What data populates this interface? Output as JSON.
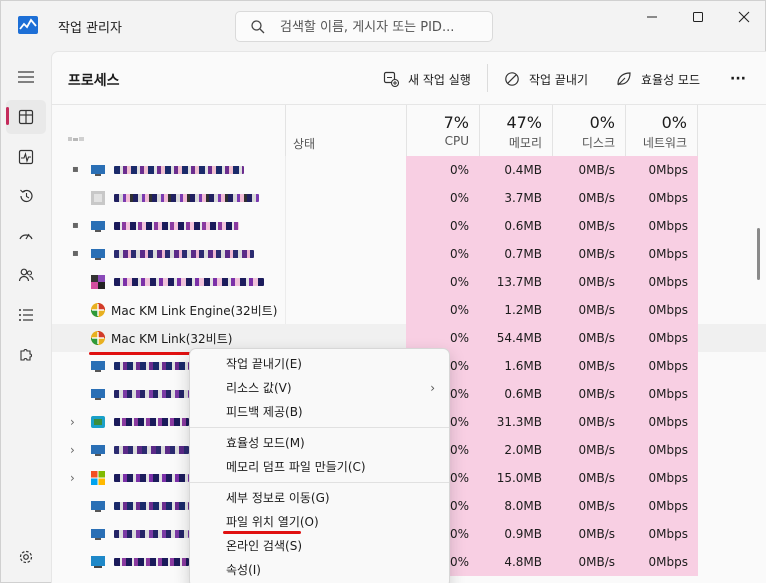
{
  "app": {
    "title": "작업 관리자"
  },
  "search": {
    "placeholder": "검색할 이름, 게시자 또는 PID..."
  },
  "page": {
    "title": "프로세스"
  },
  "toolbar": {
    "run_new_task": "새 작업 실행",
    "end_task": "작업 끝내기",
    "efficiency_mode": "효율성 모드",
    "more": "···"
  },
  "columns": {
    "name": "",
    "status": "상태",
    "cpu": {
      "pct": "7%",
      "label": "CPU"
    },
    "memory": {
      "pct": "47%",
      "label": "메모리"
    },
    "disk": {
      "pct": "0%",
      "label": "디스크"
    },
    "network": {
      "pct": "0%",
      "label": "네트워크"
    }
  },
  "rows": [
    {
      "name": "",
      "cpu": "0%",
      "mem": "0.4MB",
      "disk": "0MB/s",
      "net": "0Mbps"
    },
    {
      "name": "",
      "cpu": "0%",
      "mem": "3.7MB",
      "disk": "0MB/s",
      "net": "0Mbps"
    },
    {
      "name": "",
      "cpu": "0%",
      "mem": "0.6MB",
      "disk": "0MB/s",
      "net": "0Mbps"
    },
    {
      "name": "",
      "cpu": "0%",
      "mem": "0.7MB",
      "disk": "0MB/s",
      "net": "0Mbps"
    },
    {
      "name": "",
      "cpu": "0%",
      "mem": "13.7MB",
      "disk": "0MB/s",
      "net": "0Mbps"
    },
    {
      "name": "Mac KM Link Engine(32비트)",
      "cpu": "0%",
      "mem": "1.2MB",
      "disk": "0MB/s",
      "net": "0Mbps"
    },
    {
      "name": "Mac KM Link(32비트)",
      "cpu": "0%",
      "mem": "54.4MB",
      "disk": "0MB/s",
      "net": "0Mbps"
    },
    {
      "name": "",
      "cpu": "0%",
      "mem": "1.6MB",
      "disk": "0MB/s",
      "net": "0Mbps"
    },
    {
      "name": "",
      "cpu": "0%",
      "mem": "0.6MB",
      "disk": "0MB/s",
      "net": "0Mbps"
    },
    {
      "name": "",
      "cpu": "0%",
      "mem": "31.3MB",
      "disk": "0MB/s",
      "net": "0Mbps"
    },
    {
      "name": "",
      "cpu": "0%",
      "mem": "2.0MB",
      "disk": "0MB/s",
      "net": "0Mbps"
    },
    {
      "name": "",
      "cpu": "0%",
      "mem": "15.0MB",
      "disk": "0MB/s",
      "net": "0Mbps"
    },
    {
      "name": "",
      "cpu": "0%",
      "mem": "8.0MB",
      "disk": "0MB/s",
      "net": "0Mbps"
    },
    {
      "name": "",
      "cpu": "0%",
      "mem": "0.9MB",
      "disk": "0MB/s",
      "net": "0Mbps"
    },
    {
      "name": "",
      "cpu": "0%",
      "mem": "4.8MB",
      "disk": "0MB/s",
      "net": "0Mbps"
    }
  ],
  "context_menu": {
    "end_task": "작업 끝내기(E)",
    "resource_values": "리소스 값(V)",
    "feedback": "피드백 제공(B)",
    "efficiency_mode": "효율성 모드(M)",
    "memory_dump": "메모리 덤프 파일 만들기(C)",
    "go_to_details": "세부 정보로 이동(G)",
    "open_file_location": "파일 위치 열기(O)",
    "search_online": "온라인 검색(S)",
    "properties": "속성(I)"
  },
  "colors": {
    "highlight_cell": "#f8cfe3",
    "accent": "#c42b5b",
    "annotation_red": "#e01010"
  }
}
